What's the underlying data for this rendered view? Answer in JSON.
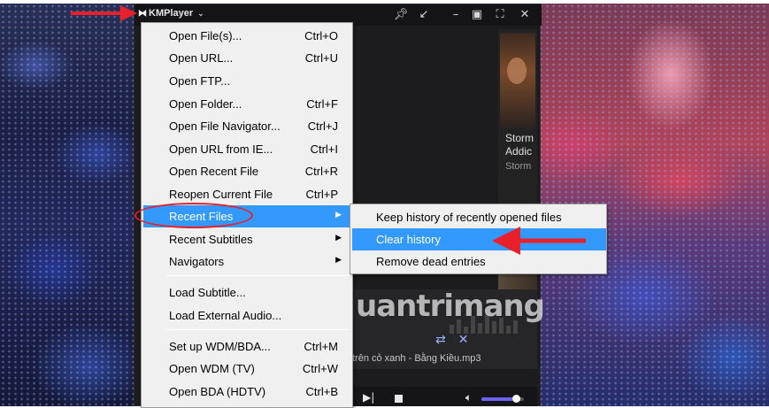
{
  "app": {
    "title": "KMPlayer",
    "logo_icon": "kmp-logo-icon",
    "title_buttons": [
      "pin-icon",
      "mini-icon",
      "minimize-icon",
      "maximize-icon",
      "fullscreen-icon",
      "close-icon"
    ]
  },
  "side_panel": {
    "line1": "Storm",
    "line2": "Addic",
    "line3": "Storm"
  },
  "player": {
    "track": "trên cỏ xanh - Bằng Kiều.mp3",
    "volume_fraction": 0.72
  },
  "watermark": "uantrimang",
  "menu": {
    "items": [
      {
        "label": "Open File(s)...",
        "shortcut": "Ctrl+O"
      },
      {
        "label": "Open URL...",
        "shortcut": "Ctrl+U"
      },
      {
        "label": "Open FTP...",
        "shortcut": ""
      },
      {
        "label": "Open Folder...",
        "shortcut": "Ctrl+F"
      },
      {
        "label": "Open File Navigator...",
        "shortcut": "Ctrl+J"
      },
      {
        "label": "Open URL from IE...",
        "shortcut": "Ctrl+I"
      },
      {
        "label": "Open Recent File",
        "shortcut": "Ctrl+R"
      },
      {
        "label": "Reopen Current File",
        "shortcut": "Ctrl+P"
      },
      {
        "label": "Recent Files",
        "shortcut": ""
      },
      {
        "label": "Recent Subtitles",
        "shortcut": ""
      },
      {
        "label": "Navigators",
        "shortcut": ""
      },
      {
        "label": "Load Subtitle...",
        "shortcut": ""
      },
      {
        "label": "Load External Audio...",
        "shortcut": ""
      },
      {
        "label": "Set up WDM/BDA...",
        "shortcut": "Ctrl+M"
      },
      {
        "label": "Open WDM (TV)",
        "shortcut": "Ctrl+W"
      },
      {
        "label": "Open BDA (HDTV)",
        "shortcut": "Ctrl+B"
      }
    ],
    "highlighted_item": "Recent Files"
  },
  "submenu": {
    "items": [
      {
        "label": "Keep history of recently opened files"
      },
      {
        "label": "Clear history"
      },
      {
        "label": "Remove dead entries"
      }
    ],
    "highlighted_item": "Clear history"
  },
  "colors": {
    "highlight": "#3399ff",
    "annotation": "#e8202a",
    "window_bg": "#1c1c1e"
  }
}
